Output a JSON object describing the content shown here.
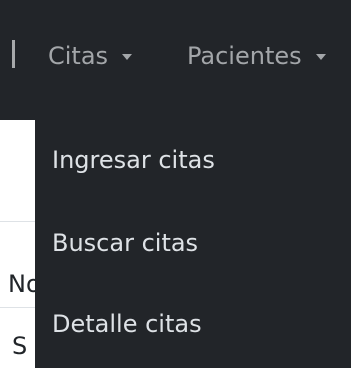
{
  "navbar": {
    "items": [
      {
        "label": "Citas"
      },
      {
        "label": "Pacientes"
      }
    ]
  },
  "dropdown": {
    "items": [
      {
        "label": "Ingresar citas"
      },
      {
        "label": "Buscar citas"
      },
      {
        "label": "Detalle citas"
      }
    ]
  },
  "background_table": {
    "header_fragment": "No",
    "cell_fragment": "S"
  },
  "colors": {
    "navbar_bg": "#222529",
    "nav_text": "#a3a6a9",
    "dropdown_text": "#dee2e6",
    "page_bg": "#ffffff"
  }
}
